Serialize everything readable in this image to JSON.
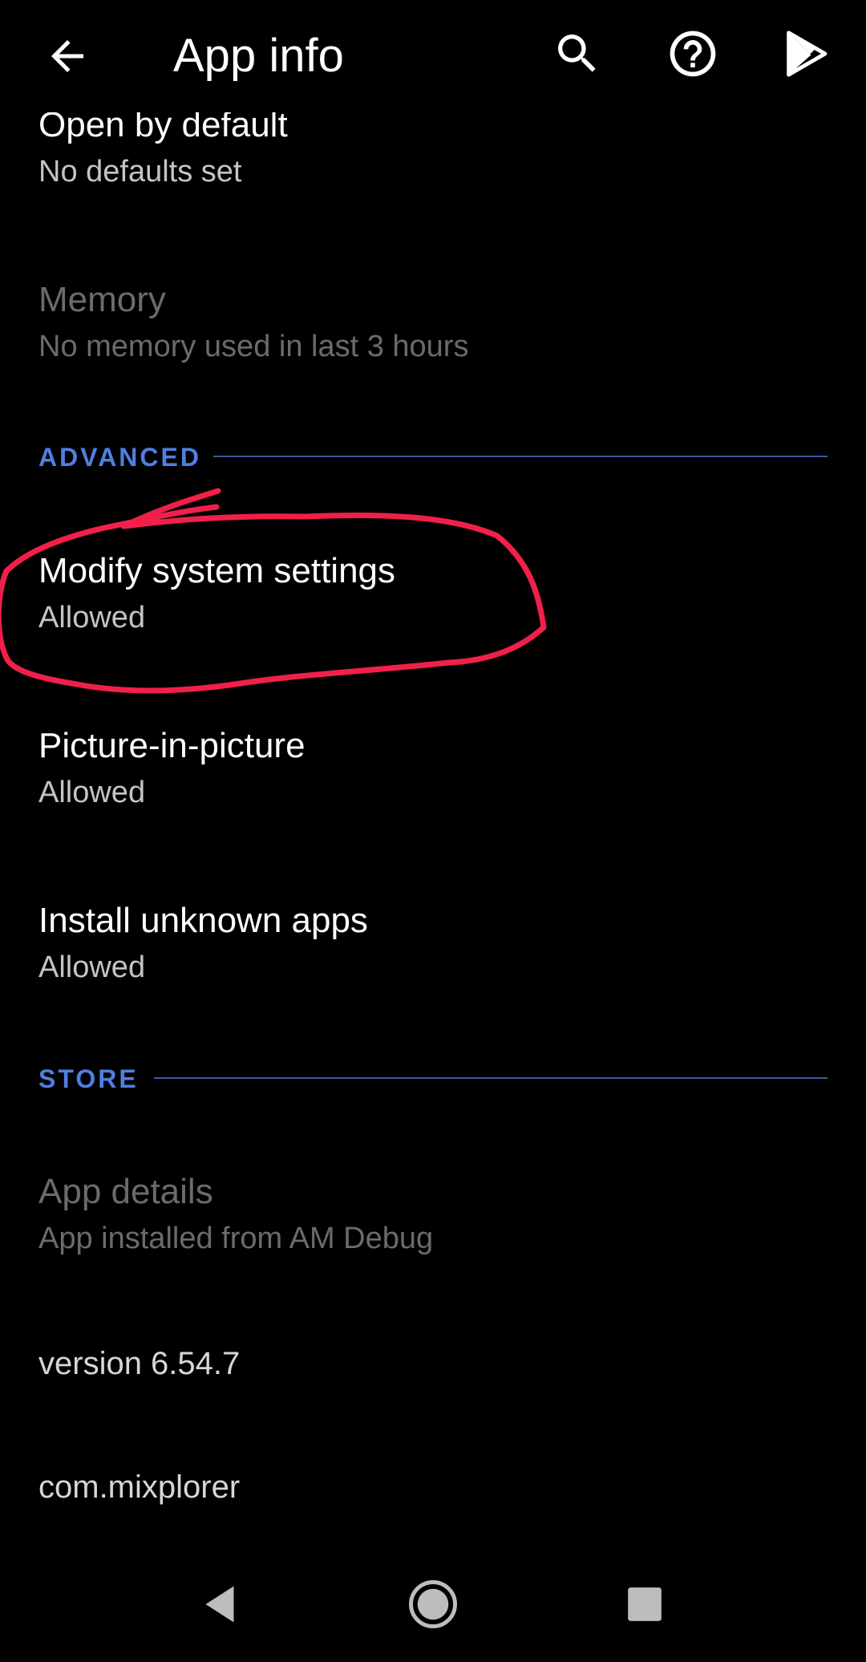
{
  "toolbar": {
    "title": "App info",
    "back_icon": "arrow-back-icon",
    "search_icon": "search-icon",
    "help_icon": "help-circle-icon",
    "store_icon": "play-store-icon"
  },
  "items": {
    "open_by_default": {
      "title": "Open by default",
      "summary": "No defaults set"
    },
    "memory": {
      "title": "Memory",
      "summary": "No memory used in last 3 hours"
    },
    "modify_system_settings": {
      "title": "Modify system settings",
      "summary": "Allowed"
    },
    "picture_in_picture": {
      "title": "Picture-in-picture",
      "summary": "Allowed"
    },
    "install_unknown_apps": {
      "title": "Install unknown apps",
      "summary": "Allowed"
    },
    "app_details": {
      "title": "App details",
      "summary": "App installed from AM Debug"
    },
    "version": {
      "title": "version 6.54.7"
    },
    "package": {
      "title": "com.mixplorer"
    }
  },
  "sections": {
    "advanced": "ADVANCED",
    "store": "STORE"
  },
  "colors": {
    "background": "#000000",
    "accent": "#4f7fe0",
    "annotation": "#f0204a",
    "disabled_text": "#6b6b6b"
  },
  "navbar": {
    "back_icon": "triangle-back-icon",
    "home_icon": "home-circle-icon",
    "recents_icon": "square-recents-icon"
  }
}
